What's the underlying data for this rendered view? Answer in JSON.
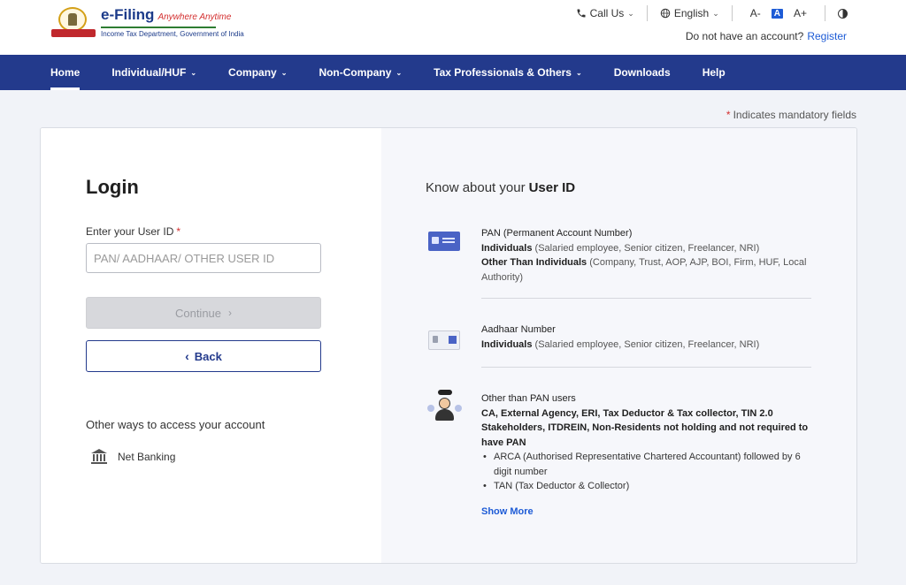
{
  "header": {
    "logo_title": "e-Filing",
    "logo_tagline": "Anywhere Anytime",
    "logo_subtitle": "Income Tax Department, Government of India",
    "call_us": "Call Us",
    "language": "English",
    "font_decrease": "A-",
    "font_default": "A",
    "font_increase": "A+",
    "account_prompt": "Do not have an account?",
    "register_label": "Register",
    "icons": [
      "phone-icon",
      "globe-icon",
      "contrast-icon"
    ]
  },
  "nav": {
    "items": [
      {
        "label": "Home",
        "has_dropdown": false,
        "active": true
      },
      {
        "label": "Individual/HUF",
        "has_dropdown": true
      },
      {
        "label": "Company",
        "has_dropdown": true
      },
      {
        "label": "Non-Company",
        "has_dropdown": true
      },
      {
        "label": "Tax Professionals & Others",
        "has_dropdown": true
      },
      {
        "label": "Downloads",
        "has_dropdown": false
      },
      {
        "label": "Help",
        "has_dropdown": false
      }
    ]
  },
  "mandatory_note": "Indicates mandatory fields",
  "login": {
    "title": "Login",
    "userid_label": "Enter your User ID",
    "userid_placeholder": "PAN/ AADHAAR/ OTHER USER ID",
    "userid_value": "",
    "continue_label": "Continue",
    "back_label": "Back",
    "other_ways": "Other ways to access your account",
    "net_banking": "Net Banking"
  },
  "know": {
    "title_prefix": "Know about your",
    "title_bold": "User ID",
    "pan": {
      "heading": "PAN (Permanent Account Number)",
      "line1_bold": "Individuals",
      "line1_rest": "(Salaried employee, Senior citizen, Freelancer, NRI)",
      "line2_bold": "Other Than Individuals",
      "line2_rest": "(Company, Trust, AOP, AJP, BOI, Firm, HUF, Local Authority)"
    },
    "aadhaar": {
      "heading": "Aadhaar Number",
      "line1_bold": "Individuals",
      "line1_rest": "(Salaried employee, Senior citizen, Freelancer, NRI)"
    },
    "other": {
      "heading": "Other than PAN users",
      "bold_text": "CA, External Agency, ERI, Tax Deductor & Tax collector, TIN 2.0 Stakeholders, ITDREIN, Non-Residents not holding and not required to have PAN",
      "bullets": [
        "ARCA (Authorised Representative Chartered Accountant) followed by 6 digit number",
        "TAN (Tax Deductor & Collector)"
      ]
    },
    "show_more": "Show More"
  }
}
